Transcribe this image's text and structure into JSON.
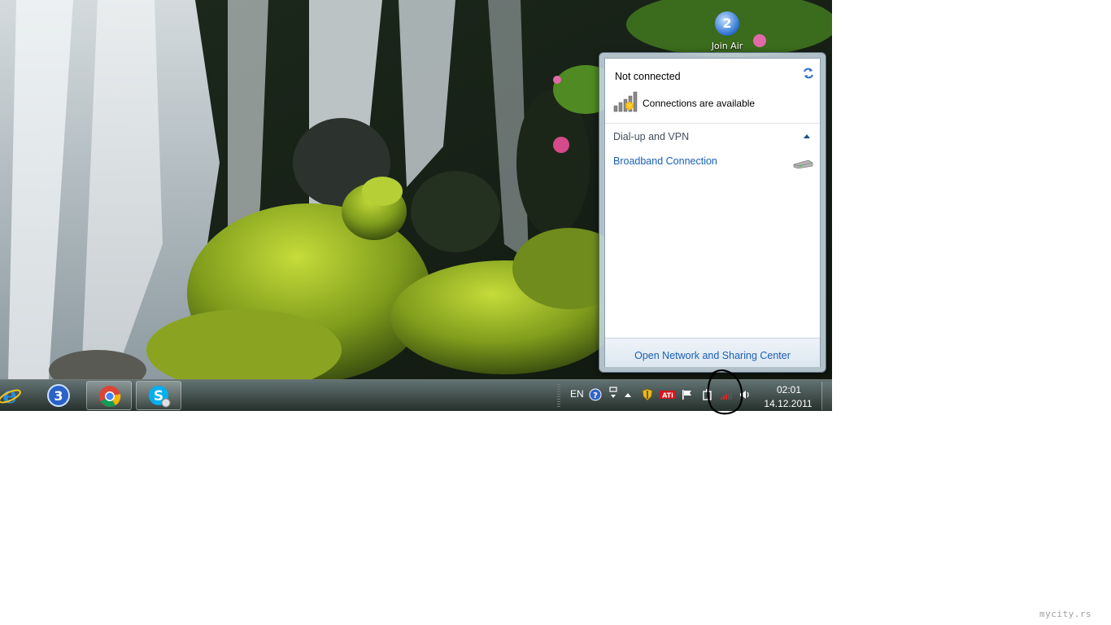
{
  "desktop": {
    "icon_label": "Join Air"
  },
  "network_flyout": {
    "status_title": "Not connected",
    "status_subtitle": "Connections are available",
    "section_header": "Dial-up and VPN",
    "connections": [
      {
        "label": "Broadband Connection",
        "icon": "modem-icon"
      }
    ],
    "footer_link": "Open Network and Sharing Center",
    "icons": {
      "refresh": "refresh-icon",
      "signal": "signal-bars-icon",
      "collapse": "chevron-up-icon"
    }
  },
  "taskbar": {
    "pinned": [
      {
        "name": "Internet Explorer",
        "icon": "ie-icon"
      },
      {
        "name": "3",
        "icon": "app-3-icon"
      },
      {
        "name": "Google Chrome",
        "icon": "chrome-icon"
      },
      {
        "name": "Skype",
        "icon": "skype-icon"
      }
    ],
    "tray": {
      "language": "EN",
      "icons": [
        "help-icon",
        "notify-icon",
        "show-hidden-icon",
        "shield-icon",
        "ati-icon",
        "action-center-flag-icon",
        "power-icon",
        "network-icon",
        "volume-icon"
      ],
      "ati_label": "ATi"
    },
    "clock": {
      "time": "02:01",
      "date": "14.12.2011"
    }
  },
  "watermark": "mycity.rs",
  "colors": {
    "link": "#1a5fb4",
    "taskbar": "#1f2a26"
  }
}
